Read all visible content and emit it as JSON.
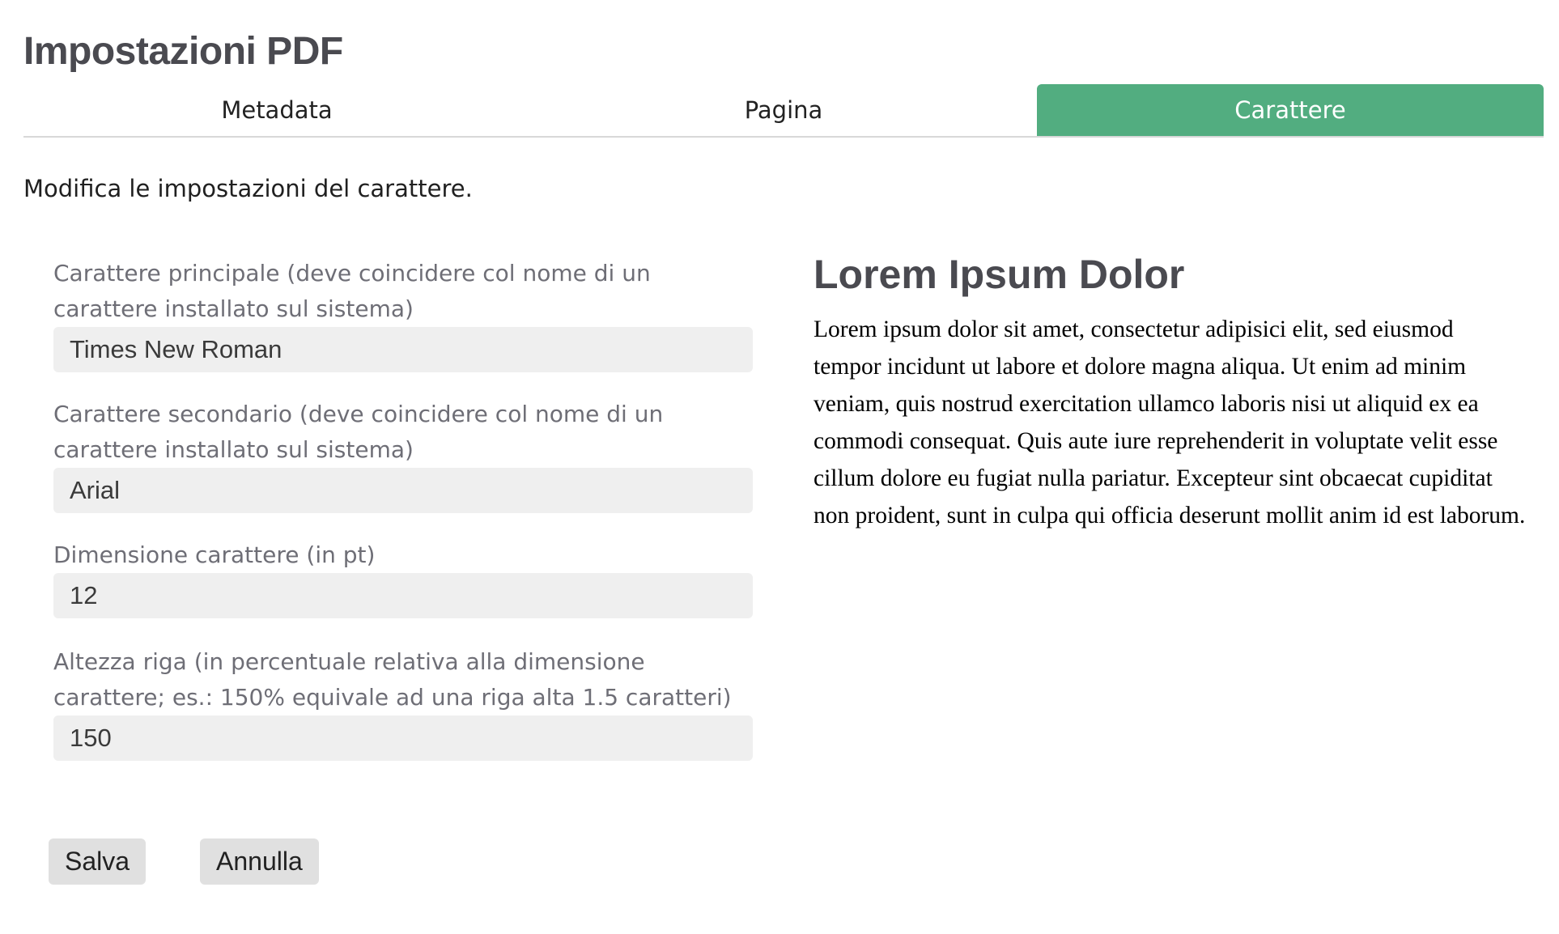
{
  "page": {
    "title": "Impostazioni PDF",
    "intro": "Modifica le impostazioni del carattere."
  },
  "tabs": [
    {
      "label": "Metadata",
      "active": false
    },
    {
      "label": "Pagina",
      "active": false
    },
    {
      "label": "Carattere",
      "active": true
    }
  ],
  "form": {
    "main_font": {
      "label": "Carattere principale (deve coincidere col nome di un carattere installato sul sistema)",
      "value": "Times New Roman"
    },
    "secondary_font": {
      "label": "Carattere secondario (deve coincidere col nome di un carattere installato sul sistema)",
      "value": "Arial"
    },
    "font_size": {
      "label": "Dimensione carattere (in pt)",
      "value": "12"
    },
    "line_height": {
      "label": "Altezza riga (in percentuale relativa alla dimensione carattere; es.: 150% equivale ad una riga alta 1.5 caratteri)",
      "value": "150"
    }
  },
  "buttons": {
    "save": "Salva",
    "cancel": "Annulla"
  },
  "preview": {
    "title": "Lorem Ipsum Dolor",
    "body": "Lorem ipsum dolor sit amet, consectetur adipisici elit, sed eiusmod tempor incidunt ut labore et dolore magna aliqua. Ut enim ad minim veniam, quis nostrud exercitation ullamco laboris nisi ut aliquid ex ea commodi consequat. Quis aute iure reprehenderit in voluptate velit esse cillum dolore eu fugiat nulla pariatur. Excepteur sint obcaecat cupiditat non proident, sunt in culpa qui officia deserunt mollit anim id est laborum."
  },
  "colors": {
    "accent": "#52ad80",
    "title": "#4a4a50",
    "input_bg": "#efefef",
    "button_bg": "#e0e0e0"
  }
}
